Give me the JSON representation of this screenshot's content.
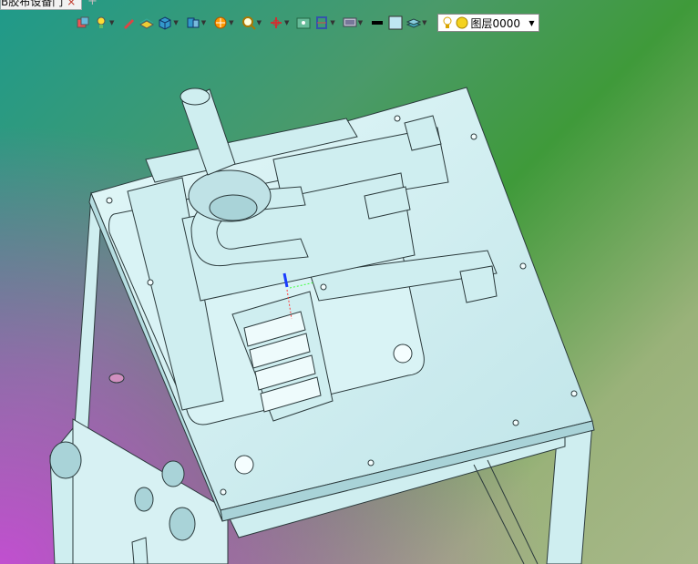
{
  "document_tab": {
    "title": "B胶布设备门",
    "close_glyph": "×"
  },
  "add_tab_glyph": "+",
  "toolbar": {
    "buttons": [
      {
        "icon": "select-icon",
        "dropdown": false
      },
      {
        "icon": "light-bulb-icon",
        "dropdown": true
      },
      {
        "icon": "pencil-icon",
        "dropdown": false
      },
      {
        "icon": "surface-icon",
        "dropdown": false
      },
      {
        "icon": "cube-icon",
        "dropdown": true
      },
      {
        "icon": "assembly-icon",
        "dropdown": true
      },
      {
        "icon": "render-sphere-icon",
        "dropdown": true
      },
      {
        "icon": "zoom-icon",
        "dropdown": true
      },
      {
        "icon": "axis-icon",
        "dropdown": true
      },
      {
        "icon": "photo-icon",
        "dropdown": false
      },
      {
        "icon": "section-icon",
        "dropdown": true
      },
      {
        "icon": "monitor-icon",
        "dropdown": true
      },
      {
        "icon": "line-style-icon",
        "dropdown": false
      },
      {
        "icon": "fill-color-icon",
        "dropdown": false
      },
      {
        "icon": "layers-icon",
        "dropdown": true
      }
    ],
    "layer_selector": {
      "value": "图层0000"
    }
  },
  "colors": {
    "part_fill": "#cfeef0",
    "part_stroke": "#2b3a3c"
  }
}
